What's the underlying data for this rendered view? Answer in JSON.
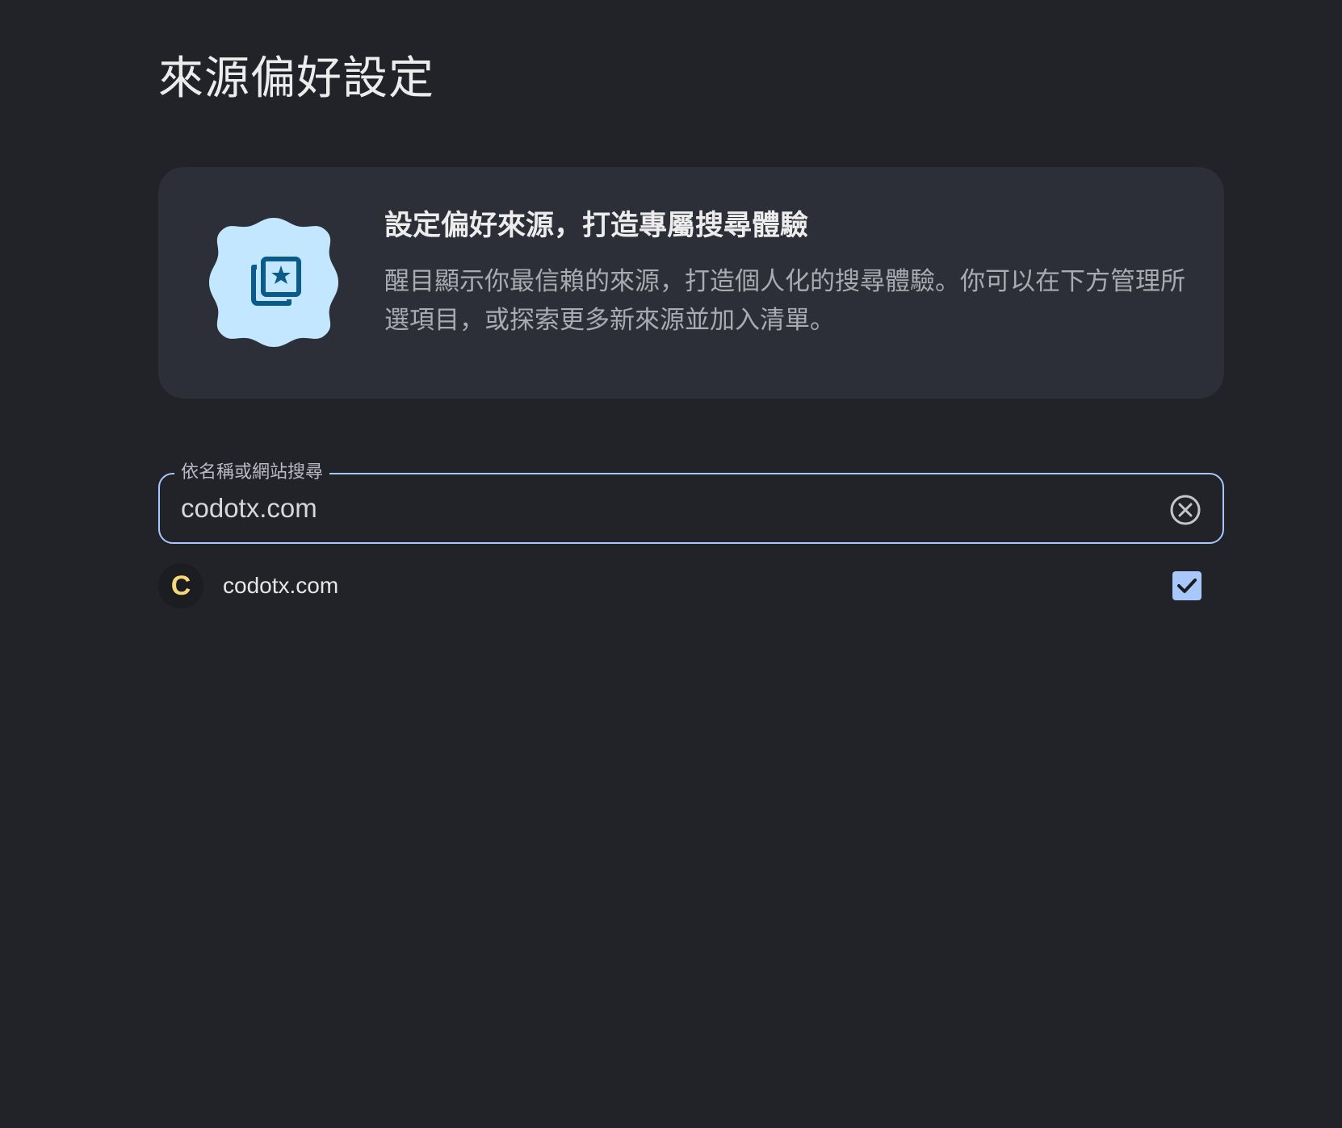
{
  "page": {
    "title": "來源偏好設定"
  },
  "info_card": {
    "icon": "star-photo-stack-icon",
    "heading": "設定偏好來源，打造專屬搜尋體驗",
    "body": "醒目顯示你最信賴的來源，打造個人化的搜尋體驗。你可以在下方管理所選項目，或探索更多新來源並加入清單。"
  },
  "search": {
    "label": "依名稱或網站搜尋",
    "value": "codotx.com",
    "clear_icon": "clear-circle-icon"
  },
  "results": [
    {
      "favicon_letter": "C",
      "name": "codotx.com",
      "checked": true
    }
  ],
  "colors": {
    "background": "#212328",
    "card": "#2d2f38",
    "accent": "#a8c7fa",
    "badge": "#c2e7ff",
    "badge_icon": "#0b5a8c",
    "favicon_letter": "#f6d77a"
  }
}
